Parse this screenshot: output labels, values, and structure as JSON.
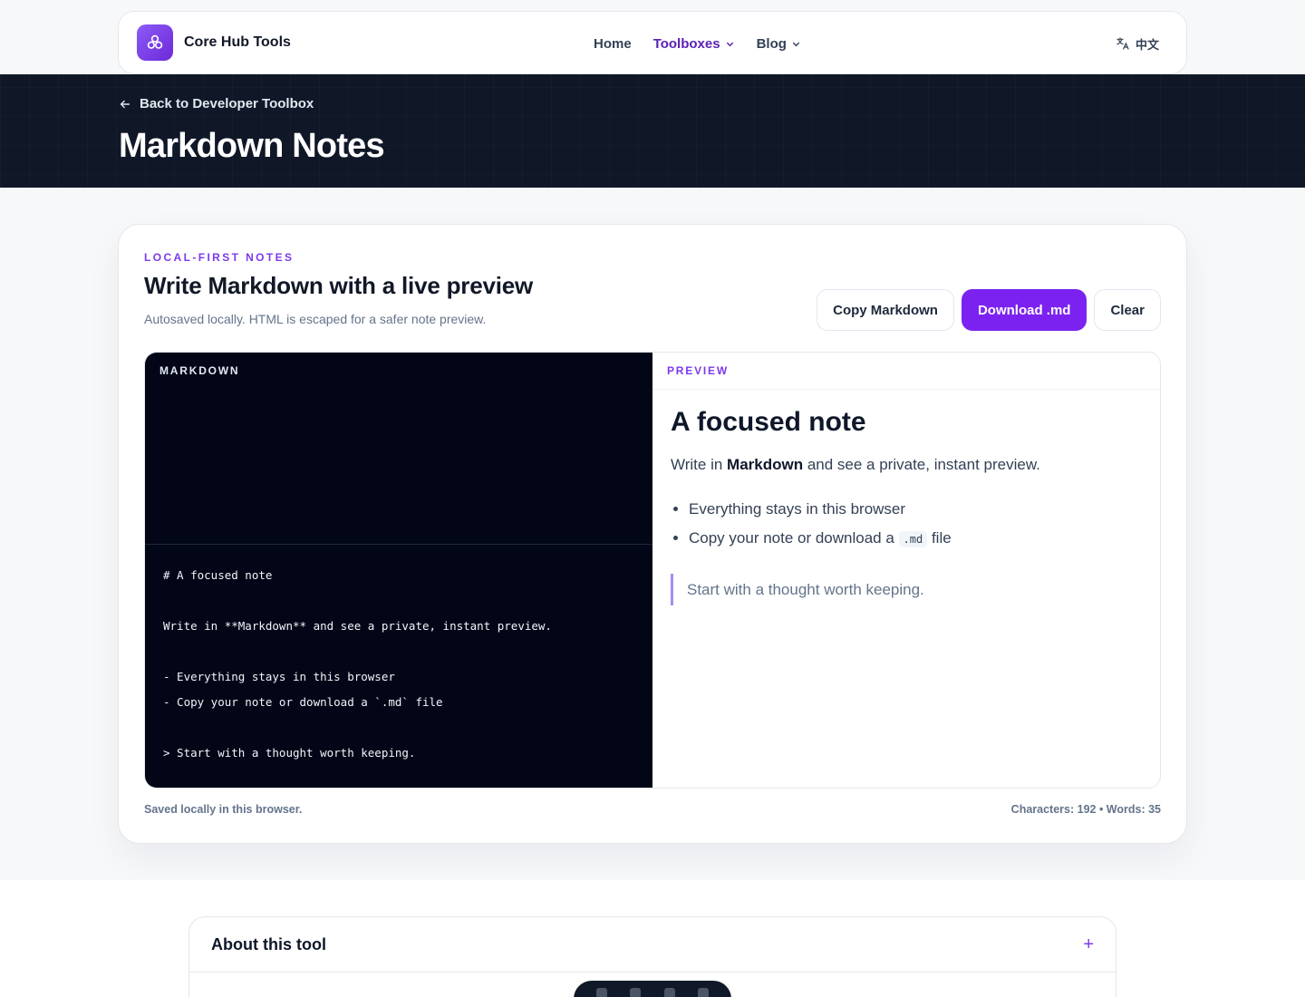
{
  "header": {
    "brand": "Core Hub Tools",
    "nav": [
      {
        "label": "Home"
      },
      {
        "label": "Toolboxes"
      },
      {
        "label": "Blog"
      }
    ],
    "language": "中文"
  },
  "hero": {
    "back_link": "Back to Developer Toolbox",
    "title": "Markdown Notes"
  },
  "card": {
    "eyebrow": "LOCAL-FIRST NOTES",
    "title": "Write Markdown with a live preview",
    "subtitle": "Autosaved locally. HTML is escaped for a safer note preview.",
    "buttons": {
      "copy": "Copy Markdown",
      "download": "Download .md",
      "clear": "Clear"
    },
    "editor": {
      "label": "MARKDOWN",
      "content": "# A focused note\n\nWrite in **Markdown** and see a private, instant preview.\n\n- Everything stays in this browser\n- Copy your note or download a `.md` file\n\n> Start with a thought worth keeping."
    },
    "preview": {
      "label": "PREVIEW",
      "heading": "A focused note",
      "para_before": "Write in ",
      "para_bold": "Markdown",
      "para_after": " and see a private, instant preview.",
      "list_1": "Everything stays in this browser",
      "list_2_before": "Copy your note or download a ",
      "list_2_code": ".md",
      "list_2_after": " file",
      "quote": "Start with a thought worth keeping."
    },
    "status": "Saved locally in this browser.",
    "stats": "Characters: 192 • Words: 35"
  },
  "faq": {
    "items": [
      {
        "label": "About this tool"
      }
    ]
  },
  "colors": {
    "accent": "#7c22f0",
    "hero_bg": "#101828",
    "editor_bg": "#020617"
  }
}
